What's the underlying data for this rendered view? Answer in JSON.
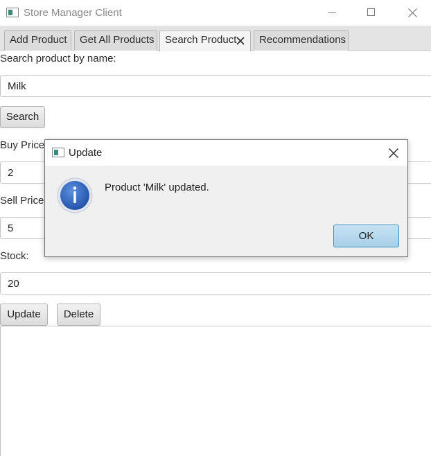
{
  "window": {
    "title": "Store Manager Client"
  },
  "tabs": [
    {
      "label": "Add Product"
    },
    {
      "label": "Get All Products"
    },
    {
      "label": "Search Product"
    },
    {
      "label": "Recommendations"
    }
  ],
  "search_form": {
    "search_label": "Search product by name:",
    "search_value": "Milk",
    "search_button": "Search",
    "buy_price_label": "Buy Price:",
    "buy_price_value": "2",
    "sell_price_label": "Sell Price:",
    "sell_price_value": "5",
    "stock_label": "Stock:",
    "stock_value": "20",
    "update_button": "Update",
    "delete_button": "Delete"
  },
  "dialog": {
    "title": "Update",
    "message": "Product 'Milk' updated.",
    "ok_button": "OK",
    "icon": "info-icon"
  },
  "icons": {
    "app": "app-icon",
    "minimize": "minimize-icon",
    "maximize": "maximize-icon",
    "close": "close-icon",
    "tab_close": "tab-close-icon"
  },
  "colors": {
    "dialog_ok_accent": "#a6cfe8",
    "info_icon": "#2f63b8",
    "tab_bar_bg": "#e4e4e4"
  }
}
